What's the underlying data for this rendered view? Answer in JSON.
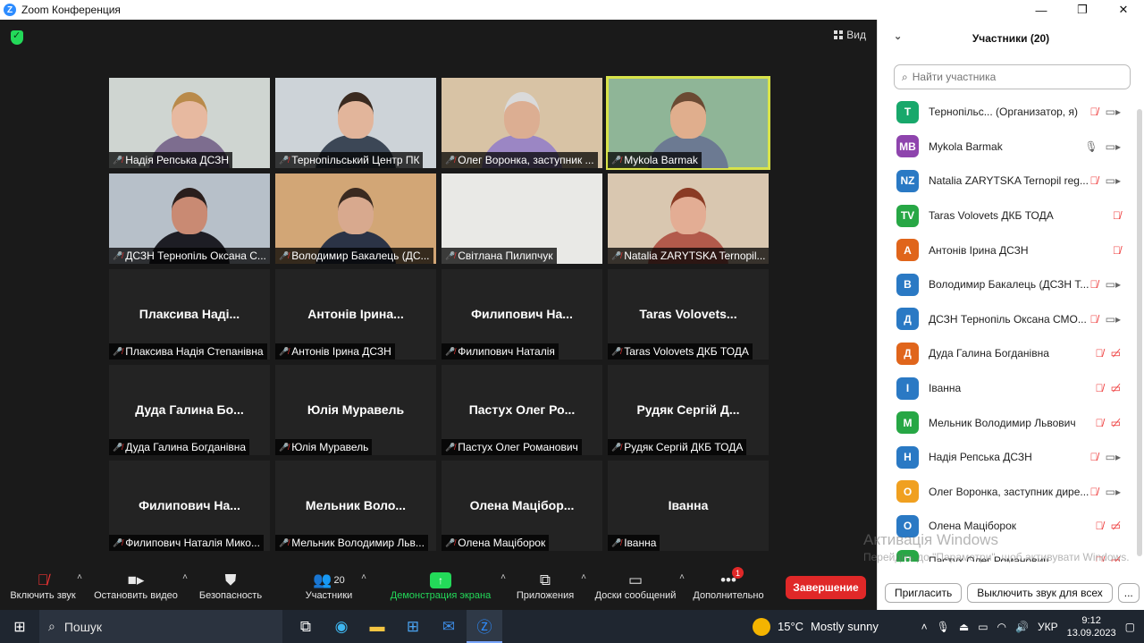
{
  "window": {
    "title": "Zoom Конференция",
    "app_icon_letter": "Z"
  },
  "view_button": "Вид",
  "tiles": [
    {
      "label": "Надія Репська ДСЗН",
      "video": true,
      "bg": "#cfd5d1",
      "skin": "#e7b9a0",
      "hair": "#b98a4a",
      "shirt": "#7d6d8f"
    },
    {
      "label": "Тернопільський Центр ПК",
      "video": true,
      "bg": "#cdd3d8",
      "skin": "#e2b59b",
      "hair": "#3a2a20",
      "shirt": "#3c4756"
    },
    {
      "label": "Олег Воронка, заступник ...",
      "video": true,
      "bg": "#d8c3a5",
      "skin": "#dcae92",
      "hair": "#dadada",
      "shirt": "#9b86c4"
    },
    {
      "label": "Mykola Barmak",
      "video": true,
      "active": true,
      "bg": "#8fb597",
      "skin": "#e0ae8d",
      "hair": "#6b4a33",
      "shirt": "#6c7a92"
    },
    {
      "label": "ДСЗН Тернопіль Оксана С...",
      "video": true,
      "bg": "#b7c0c9",
      "skin": "#c98a73",
      "hair": "#2a1e1c",
      "shirt": "#1d1d24"
    },
    {
      "label": "Володимир Бакалець (ДС...",
      "video": true,
      "bg": "#d2a676",
      "skin": "#d8a98e",
      "hair": "#3a2a20",
      "shirt": "#2b3346"
    },
    {
      "label": "Світлана Пилипчук",
      "video": true,
      "bg": "#e9e9e6",
      "empty": true
    },
    {
      "label": "Natalia ZARYTSKA Ternopil...",
      "video": true,
      "bg": "#d9c7b0",
      "skin": "#e3ad94",
      "hair": "#8a3b24",
      "shirt": "#b25a4b"
    },
    {
      "center": "Плаксива Наді...",
      "label": "Плаксива Надія Степанівна"
    },
    {
      "center": "Антонів Ірина...",
      "label": "Антонів Ірина ДСЗН"
    },
    {
      "center": "Филипович На...",
      "label": "Филипович Наталія"
    },
    {
      "center": "Taras Volovets...",
      "label": "Taras Volovets ДКБ ТОДА"
    },
    {
      "center": "Дуда Галина Бо...",
      "label": "Дуда Галина Богданівна"
    },
    {
      "center": "Юлія Муравель",
      "label": "Юлія Муравель"
    },
    {
      "center": "Пастух Олег Ро...",
      "label": "Пастух Олег Романович"
    },
    {
      "center": "Рудяк Сергій Д...",
      "label": "Рудяк Сергій ДКБ ТОДА"
    },
    {
      "center": "Филипович На...",
      "label": "Филипович Наталія Мико..."
    },
    {
      "center": "Мельник Воло...",
      "label": "Мельник Володимир Льв..."
    },
    {
      "center": "Олена Мацібор...",
      "label": "Олена Маціборок"
    },
    {
      "center": "Іванна",
      "label": "Іванна"
    }
  ],
  "toolbar": {
    "audio": "Включить звук",
    "video": "Остановить видео",
    "security": "Безопасность",
    "participants": "Участники",
    "participants_count": "20",
    "share": "Демонстрация экрана",
    "apps": "Приложения",
    "whiteboards": "Доски сообщений",
    "more": "Дополнительно",
    "more_badge": "1",
    "end": "Завершение"
  },
  "panel": {
    "title": "Участники (20)",
    "search_placeholder": "Найти участника",
    "invite": "Пригласить",
    "mute_all": "Выключить звук для всех",
    "more": "..."
  },
  "participants": [
    {
      "initials": "T",
      "name": "Тернопільс... (Организатор, я)",
      "color": "#18a86b",
      "icons": [
        "mic-off",
        "cam"
      ]
    },
    {
      "initials": "MB",
      "name": "Mykola Barmak",
      "color": "#8e44ad",
      "icons": [
        "mic",
        "cam"
      ]
    },
    {
      "initials": "NZ",
      "name": "Natalia ZARYTSKA Ternopil reg...",
      "color": "#2a79c4",
      "icons": [
        "mic-off",
        "cam"
      ]
    },
    {
      "initials": "TV",
      "name": "Taras Volovets ДКБ ТОДА",
      "color": "#27a745",
      "icons": [
        "mic-off"
      ]
    },
    {
      "initials": "A",
      "name": "Антонів Ірина ДСЗН",
      "color": "#e0651b",
      "icons": [
        "mic-off"
      ]
    },
    {
      "initials": "B",
      "name": "Володимир Бакалець (ДСЗН Т...",
      "color": "#2a79c4",
      "icons": [
        "mic-off",
        "cam"
      ]
    },
    {
      "initials": "Д",
      "name": "ДСЗН Тернопіль Оксана СМО...",
      "color": "#2a79c4",
      "icons": [
        "mic-off",
        "cam"
      ]
    },
    {
      "initials": "Д",
      "name": "Дуда Галина Богданівна",
      "color": "#e0651b",
      "icons": [
        "mic-off",
        "cam-off"
      ]
    },
    {
      "initials": "І",
      "name": "Іванна",
      "color": "#2a79c4",
      "icons": [
        "mic-off",
        "cam-off"
      ]
    },
    {
      "initials": "M",
      "name": "Мельник Володимир Львович",
      "color": "#27a745",
      "icons": [
        "mic-off",
        "cam-off"
      ]
    },
    {
      "initials": "Н",
      "name": "Надія Репська ДСЗН",
      "color": "#2a79c4",
      "icons": [
        "mic-off",
        "cam"
      ]
    },
    {
      "initials": "О",
      "name": "Олег Воронка, заступник дире...",
      "color": "#f0a020",
      "icons": [
        "mic-off",
        "cam"
      ]
    },
    {
      "initials": "О",
      "name": "Олена Маціборок",
      "color": "#2a79c4",
      "icons": [
        "mic-off",
        "cam-off"
      ]
    },
    {
      "initials": "П",
      "name": "Пастух Олег Романович",
      "color": "#27a745",
      "icons": [
        "mic-off",
        "cam-off"
      ]
    }
  ],
  "watermark": {
    "title": "Активація Windows",
    "text": "Перейдіть до \"Параметри\", щоб активувати Windows."
  },
  "taskbar": {
    "search": "Пошук",
    "weather_temp": "15°C",
    "weather_text": "Mostly sunny",
    "lang": "УКР",
    "time": "9:12",
    "date": "13.09.2023"
  }
}
